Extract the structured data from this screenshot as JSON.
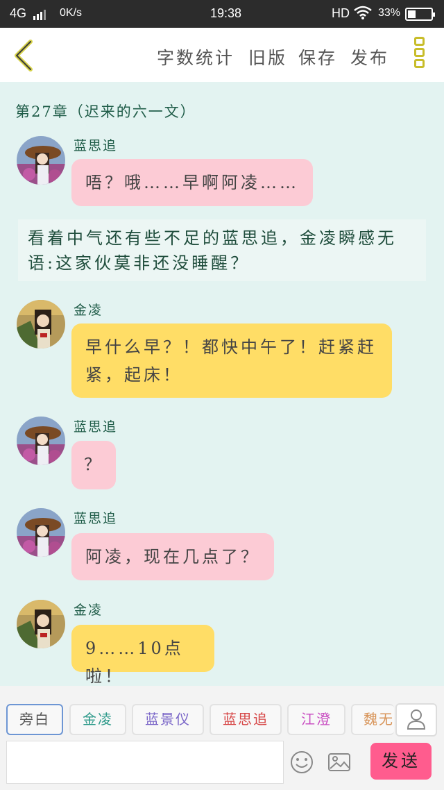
{
  "status_bar": {
    "network": "4G",
    "speed": "0K/s",
    "time": "19:38",
    "hd": "HD",
    "battery": "33%",
    "battery_level": 0.33
  },
  "toolbar": {
    "word_count_label": "字数统计",
    "old_version_label": "旧版",
    "save_label": "保存",
    "publish_label": "发布"
  },
  "chapter_title": "第27章（迟来的六一文）",
  "messages": [
    {
      "speaker": "蓝思追",
      "text": "唔？哦……早啊阿凌……"
    },
    {
      "speaker": "金凌",
      "text": "早什么早？！都快中午了！赶紧赶紧，起床！"
    },
    {
      "speaker": "蓝思追",
      "text": "？"
    },
    {
      "speaker": "蓝思追",
      "text": "阿凌，现在几点了？"
    },
    {
      "speaker": "金凌",
      "text": "9……10点啦！"
    }
  ],
  "narration": "看着中气还有些不足的蓝思追，金凌瞬感无语:这家伙莫非还没睡醒？",
  "characters": [
    {
      "label": "旁白",
      "color": "#555555"
    },
    {
      "label": "金凌",
      "color": "#2e9a8a"
    },
    {
      "label": "蓝景仪",
      "color": "#7a66c8"
    },
    {
      "label": "蓝思追",
      "color": "#d64545"
    },
    {
      "label": "江澄",
      "color": "#c94fc2"
    },
    {
      "label": "魏无",
      "color": "#d8955a"
    }
  ],
  "send_label": "发送",
  "icons": {
    "back": "chevron-left-icon",
    "more": "more-vertical-icon",
    "user": "user-icon",
    "emoji": "emoji-icon",
    "image": "image-icon"
  }
}
